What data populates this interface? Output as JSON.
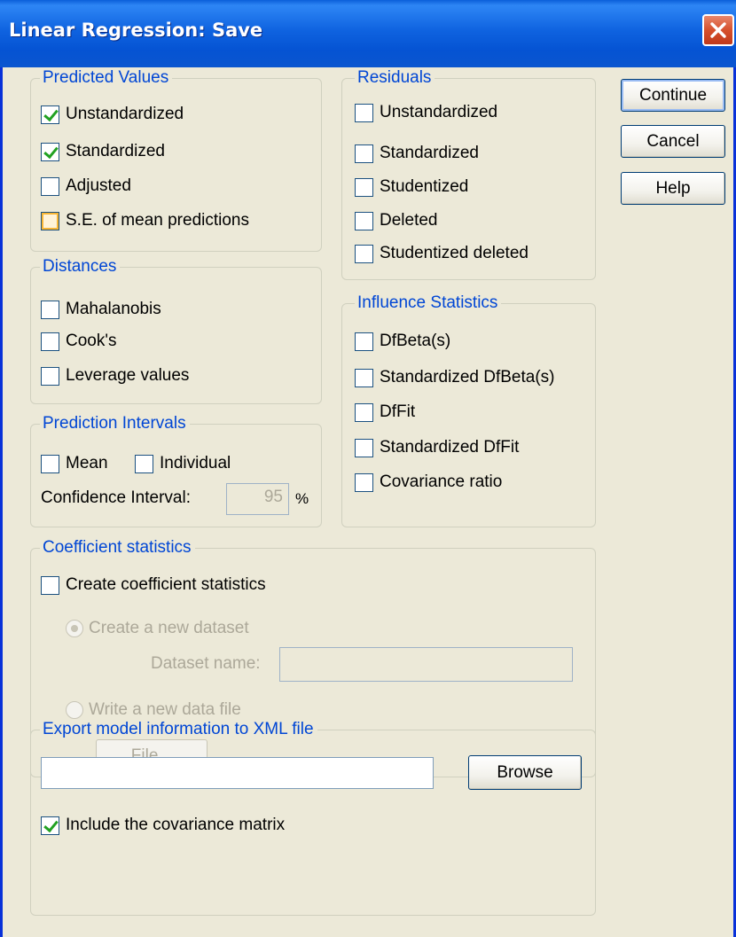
{
  "window": {
    "title": "Linear Regression: Save"
  },
  "buttons": {
    "continue": "Continue",
    "cancel": "Cancel",
    "help": "Help"
  },
  "predicted_values": {
    "legend": "Predicted Values",
    "items": [
      {
        "label": "Unstandardized",
        "checked": true
      },
      {
        "label": "Standardized",
        "checked": true
      },
      {
        "label": "Adjusted",
        "checked": false
      },
      {
        "label": "S.E. of mean predictions",
        "checked": false
      }
    ]
  },
  "distances": {
    "legend": "Distances",
    "items": [
      {
        "label": "Mahalanobis",
        "checked": false
      },
      {
        "label": "Cook's",
        "checked": false
      },
      {
        "label": "Leverage values",
        "checked": false
      }
    ]
  },
  "prediction_intervals": {
    "legend": "Prediction Intervals",
    "mean": "Mean",
    "individual": "Individual",
    "ci_label": "Confidence Interval:",
    "ci_value": "95",
    "ci_unit": "%"
  },
  "residuals": {
    "legend": "Residuals",
    "items": [
      {
        "label": "Unstandardized",
        "checked": false
      },
      {
        "label": "Standardized",
        "checked": false
      },
      {
        "label": "Studentized",
        "checked": false
      },
      {
        "label": "Deleted",
        "checked": false
      },
      {
        "label": "Studentized deleted",
        "checked": false
      }
    ]
  },
  "influence": {
    "legend": "Influence Statistics",
    "items": [
      {
        "label": "DfBeta(s)",
        "checked": false
      },
      {
        "label": "Standardized DfBeta(s)",
        "checked": false
      },
      {
        "label": "DfFit",
        "checked": false
      },
      {
        "label": "Standardized DfFit",
        "checked": false
      },
      {
        "label": "Covariance ratio",
        "checked": false
      }
    ]
  },
  "coefficient": {
    "legend": "Coefficient statistics",
    "create": "Create coefficient statistics",
    "new_dataset": "Create a new dataset",
    "dataset_name": "Dataset name:",
    "dataset_value": "",
    "new_file": "Write a new data file",
    "file_button": "File..."
  },
  "export": {
    "legend": "Export model information to XML file",
    "path_value": "",
    "browse": "Browse",
    "include_cov": "Include the covariance matrix",
    "include_cov_checked": true
  },
  "colors": {
    "title_bar": "#0553d3",
    "legend_text": "#0046d5",
    "dialog_bg": "#ece9d8",
    "check_mark": "#21a121"
  },
  "icons": {
    "close": "close-icon"
  }
}
